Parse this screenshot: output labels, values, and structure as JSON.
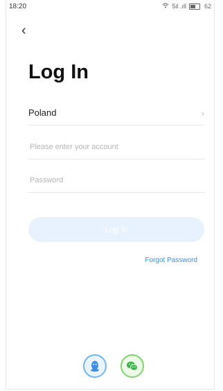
{
  "status": {
    "time": "18:20",
    "signal_text": "5il .ıll",
    "battery_text": "62"
  },
  "header": {
    "back_label": "‹",
    "title": "Log In"
  },
  "form": {
    "country": {
      "label": "Poland",
      "chevron": "›"
    },
    "account": {
      "value": "",
      "placeholder": "Please enter your account"
    },
    "password": {
      "value": "",
      "placeholder": "Password"
    },
    "login_button": "Log In",
    "forgot_link": "Forgot Password"
  },
  "social": {
    "qq_icon": "qq-icon",
    "wechat_icon": "wechat-icon"
  },
  "colors": {
    "accent": "#3b8eea",
    "button_bg_disabled": "#e8f2ff",
    "qq": "#6eb5ff",
    "wechat": "#7ed56b"
  }
}
